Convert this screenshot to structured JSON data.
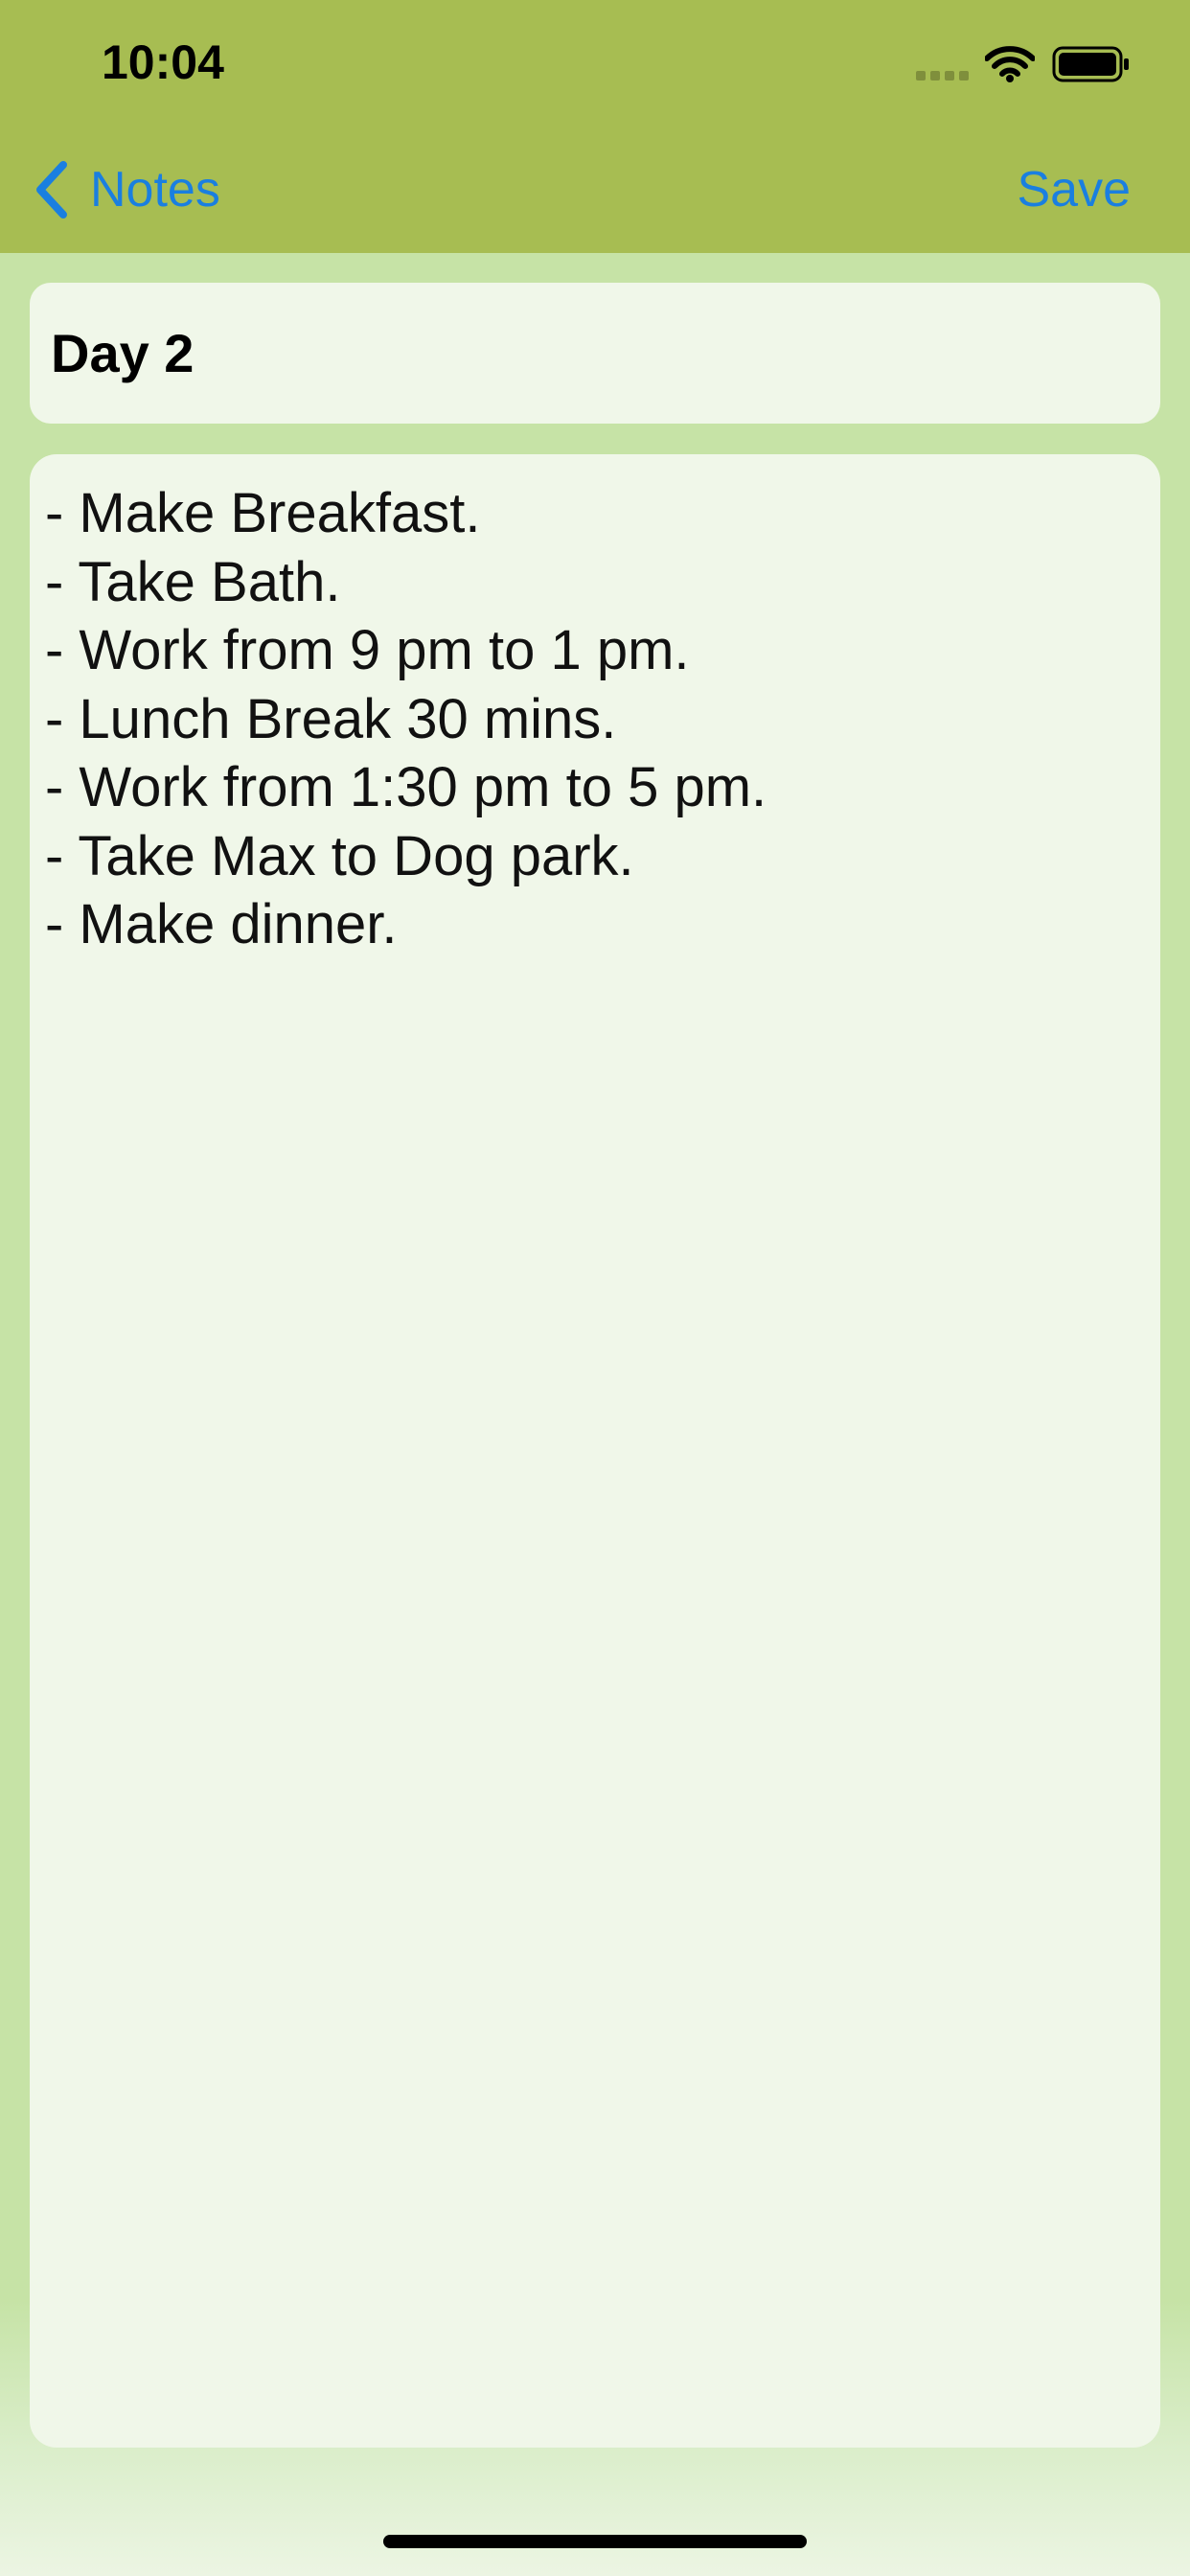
{
  "status_bar": {
    "time": "10:04"
  },
  "nav": {
    "back_label": "Notes",
    "save_label": "Save",
    "accent_color": "#1a7fe0",
    "bar_color": "#a7bd52"
  },
  "note": {
    "title": "Day 2",
    "lines": [
      "- Make Breakfast.",
      "- Take Bath.",
      "- Work from 9 pm to 1 pm.",
      "- Lunch Break 30 mins.",
      "- Work from 1:30 pm to 5 pm.",
      "- Take Max to Dog park.",
      "- Make dinner."
    ]
  },
  "icons": {
    "back": "chevron-left-icon",
    "signal": "cellular-signal-icon",
    "wifi": "wifi-icon",
    "battery": "battery-icon"
  }
}
